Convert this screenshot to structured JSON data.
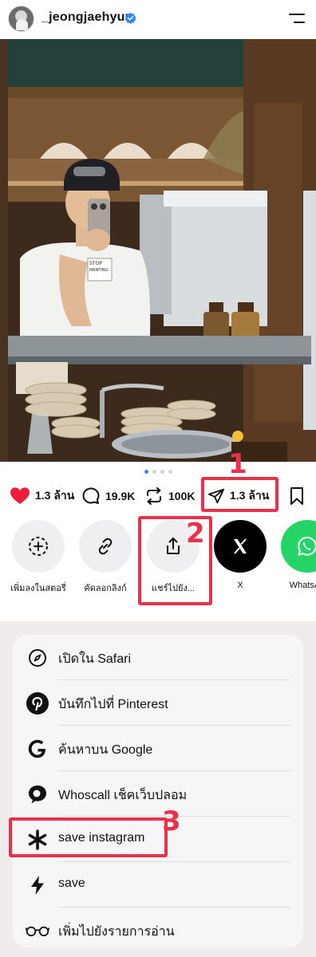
{
  "header": {
    "username": "_jeongjaehyun",
    "verified_icon": "verified-badge-icon",
    "menu_icon": "hamburger-menu-icon"
  },
  "photo": {
    "tshirt_text": "STOP PAINTING"
  },
  "carousel": {
    "count": 4,
    "active": 0
  },
  "actions": {
    "likes": "1.3 ล้าน",
    "comments": "19.9K",
    "reposts": "100K",
    "shares": "1.3 ล้าน"
  },
  "share_options": [
    {
      "label": "เพิ่มลงในสตอรี่",
      "icon": "add-story-icon"
    },
    {
      "label": "คัดลอกลิงก์",
      "icon": "link-icon"
    },
    {
      "label": "แชร์ไปยัง...",
      "icon": "share-upload-icon"
    },
    {
      "label": "X",
      "icon": "x-logo-icon"
    },
    {
      "label": "WhatsAp",
      "icon": "whatsapp-icon"
    }
  ],
  "menu": [
    {
      "label": "เปิดใน Safari",
      "icon": "compass-icon"
    },
    {
      "label": "บันทึกไปที่ Pinterest",
      "icon": "pinterest-icon"
    },
    {
      "label": "ค้นหาบน Google",
      "icon": "google-icon"
    },
    {
      "label": "Whoscall เช็คเว็บปลอม",
      "icon": "whoscall-icon"
    },
    {
      "label": "save instagram",
      "icon": "asterisk-icon"
    },
    {
      "label": "save",
      "icon": "lightning-icon"
    },
    {
      "label": "เพิ่มไปยังรายการอ่าน",
      "icon": "glasses-icon"
    }
  ],
  "annotations": [
    "1",
    "2",
    "3"
  ],
  "colors": {
    "highlight": "#e8314b",
    "heart": "#ed1c3d",
    "carousel_active": "#3b82f6",
    "verified": "#2f8cf5"
  }
}
